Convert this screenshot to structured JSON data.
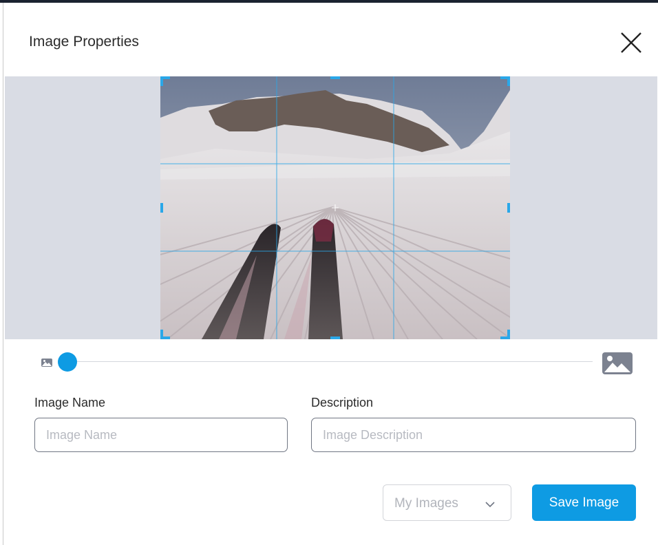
{
  "dialog": {
    "title": "Image Properties"
  },
  "crop": {
    "zoom_level": 0,
    "guide_color": "#2aa7e8",
    "canvas_color": "#d9dce4"
  },
  "icons": {
    "close": "close-icon",
    "zoom_out": "small-image-icon",
    "zoom_in": "large-image-icon",
    "dropdown": "chevron-down-icon"
  },
  "form": {
    "name_label": "Image Name",
    "name_placeholder": "Image Name",
    "name_value": "",
    "description_label": "Description",
    "description_placeholder": "Image Description",
    "description_value": ""
  },
  "footer": {
    "folder_selected": "My Images",
    "save_label": "Save Image"
  },
  "colors": {
    "accent": "#0e9be3",
    "text": "#2b2b2b",
    "placeholder": "#b7bac1"
  }
}
